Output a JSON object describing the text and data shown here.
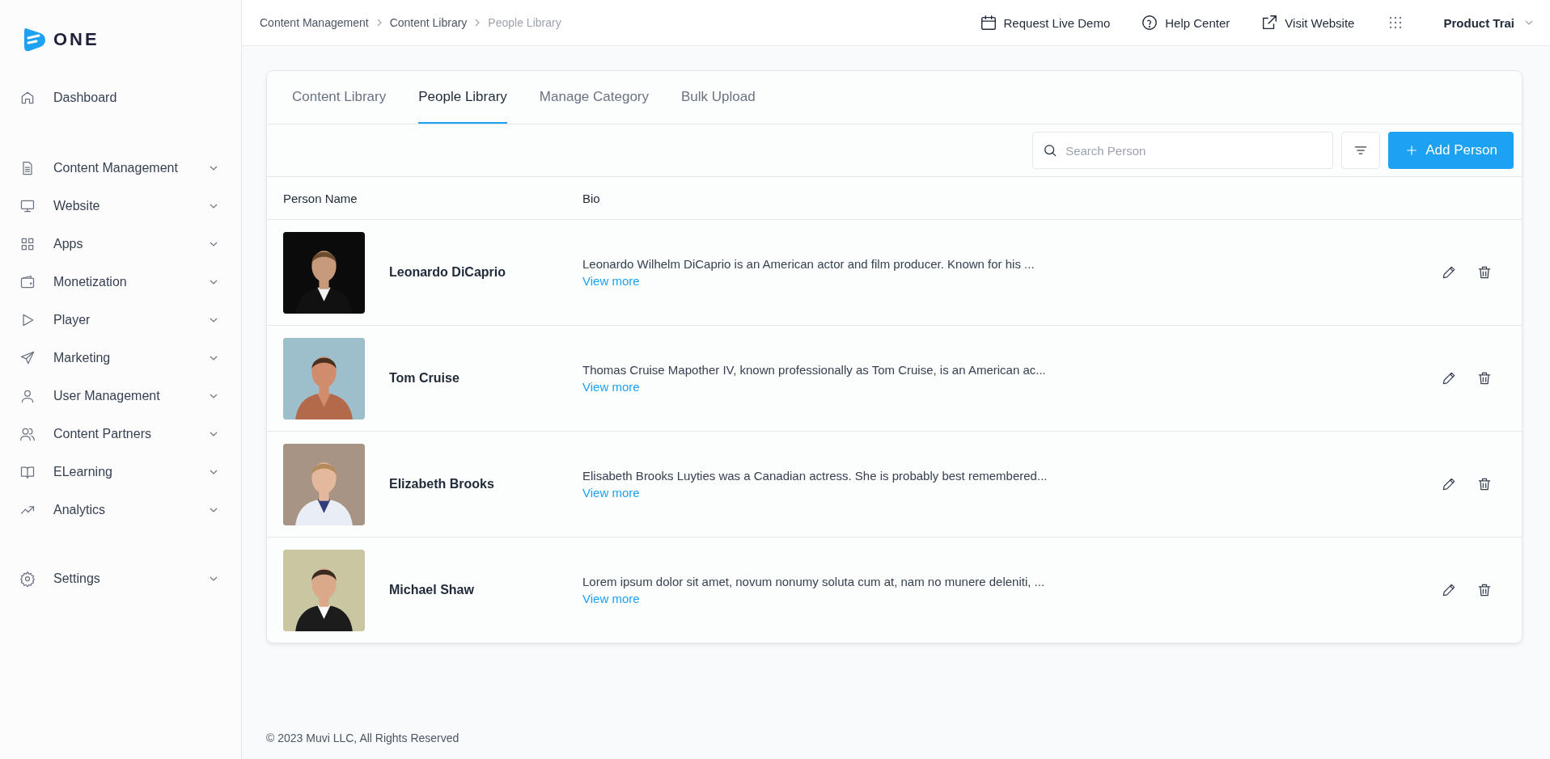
{
  "logo": {
    "text": "ONE"
  },
  "sidebar": {
    "items": [
      {
        "label": "Dashboard",
        "kind": "link"
      },
      {
        "label": "Content Management",
        "kind": "menu"
      },
      {
        "label": "Website",
        "kind": "menu"
      },
      {
        "label": "Apps",
        "kind": "menu"
      },
      {
        "label": "Monetization",
        "kind": "menu"
      },
      {
        "label": "Player",
        "kind": "menu"
      },
      {
        "label": "Marketing",
        "kind": "menu"
      },
      {
        "label": "User Management",
        "kind": "menu"
      },
      {
        "label": "Content Partners",
        "kind": "menu"
      },
      {
        "label": "ELearning",
        "kind": "menu"
      },
      {
        "label": "Analytics",
        "kind": "menu"
      }
    ],
    "bottom_items": [
      {
        "label": "Settings",
        "kind": "menu"
      }
    ]
  },
  "breadcrumb": [
    {
      "label": "Content Management",
      "current": false
    },
    {
      "label": "Content Library",
      "current": false
    },
    {
      "label": "People Library",
      "current": true
    }
  ],
  "header_links": [
    {
      "label": "Request Live Demo"
    },
    {
      "label": "Help Center"
    },
    {
      "label": "Visit Website"
    }
  ],
  "user_menu": {
    "label": "Product Trai"
  },
  "tabs": [
    {
      "label": "Content Library",
      "selected": false
    },
    {
      "label": "People Library",
      "selected": true
    },
    {
      "label": "Manage Category",
      "selected": false
    },
    {
      "label": "Bulk Upload",
      "selected": false
    }
  ],
  "search": {
    "placeholder": "Search Person"
  },
  "add_button": {
    "label": "Add Person"
  },
  "table": {
    "columns": [
      "Person Name",
      "Bio"
    ],
    "rows": [
      {
        "name": "Leonardo DiCaprio",
        "bio": "Leonardo Wilhelm DiCaprio is an American actor and film producer. Known for his ...",
        "link": "View more"
      },
      {
        "name": "Tom Cruise",
        "bio": "Thomas Cruise Mapother IV, known professionally as Tom Cruise, is an American ac...",
        "link": "View more"
      },
      {
        "name": "Elizabeth Brooks",
        "bio": "Elisabeth Brooks Luyties was a Canadian actress. She is probably best remembered...",
        "link": "View more"
      },
      {
        "name": "Michael Shaw",
        "bio": "Lorem ipsum dolor sit amet, novum nonumy soluta cum at, nam no munere deleniti, ...",
        "link": "View more"
      }
    ]
  },
  "footer": {
    "text": "© 2023 Muvi LLC, All Rights Reserved"
  }
}
